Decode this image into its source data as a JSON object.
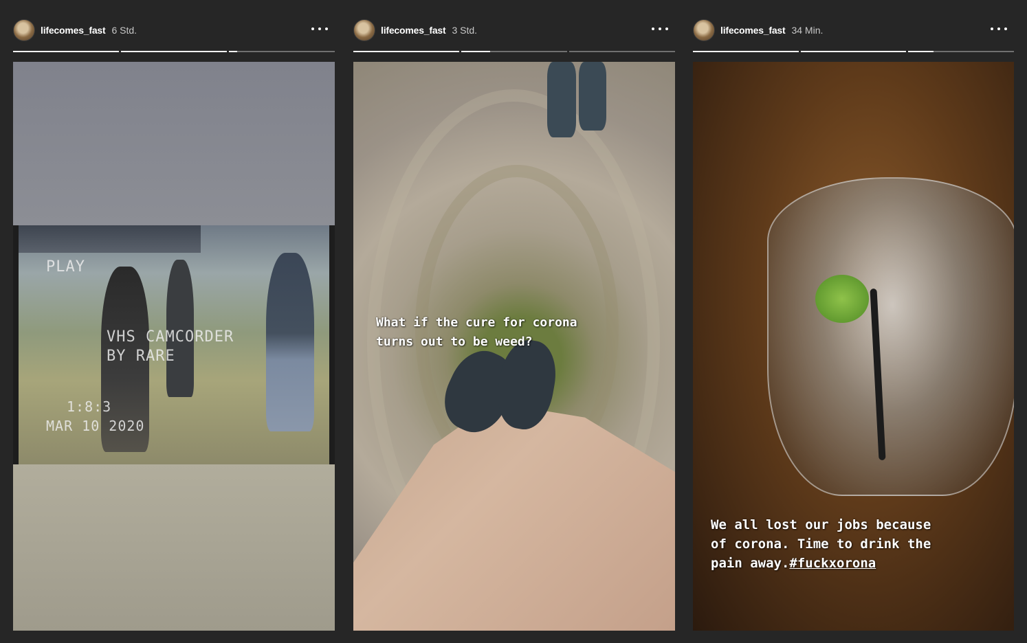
{
  "stories": [
    {
      "username": "lifecomes_fast",
      "time": "6 Std.",
      "progress": [
        1.0,
        1.0,
        0.08
      ],
      "overlay": {
        "line1": "PLAY",
        "line2": "VHS CAMCORDER",
        "line3": "BY RARE",
        "line4": "1:8:3",
        "line5": "MAR 10 2020"
      }
    },
    {
      "username": "lifecomes_fast",
      "time": "3 Std.",
      "progress": [
        1.0,
        0.27,
        0.0
      ],
      "caption": "What if the cure for corona\nturns out to be weed?"
    },
    {
      "username": "lifecomes_fast",
      "time": "34 Min.",
      "progress": [
        1.0,
        1.0,
        0.24
      ],
      "caption": "We all lost our jobs because\nof corona. Time to drink the\npain away.",
      "hashtag": "#fuckxorona"
    }
  ],
  "icons": {
    "more": "more-options-icon",
    "avatar": "profile-avatar"
  }
}
